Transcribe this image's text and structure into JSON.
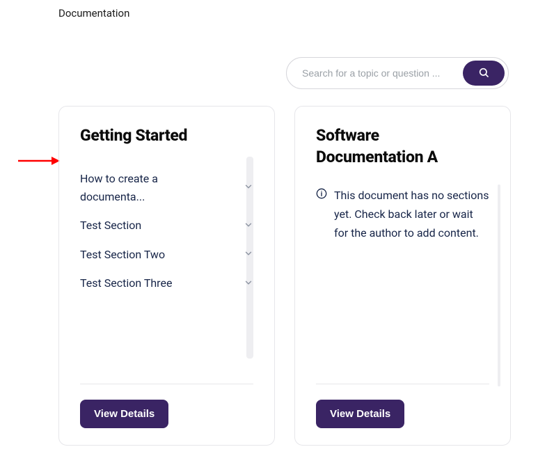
{
  "page": {
    "title": "Documentation"
  },
  "search": {
    "placeholder": "Search for a topic or question ..."
  },
  "cards": {
    "a": {
      "title": "Getting Started",
      "sections": [
        "How to create a documenta...",
        "Test Section",
        "Test Section Two",
        "Test Section Three"
      ],
      "cta": "View Details"
    },
    "b": {
      "title": "Software Documentation A",
      "empty_message": "This document has no sections yet. Check back later or wait for the author to add content.",
      "cta": "View Details"
    }
  }
}
